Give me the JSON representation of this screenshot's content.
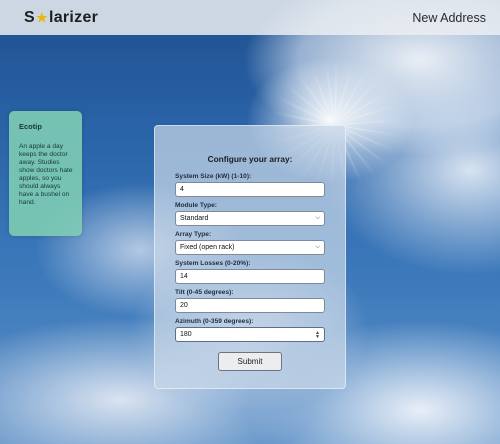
{
  "navbar": {
    "logo_prefix": "S",
    "logo_suffix": "larizer",
    "logo_sun": "★",
    "link": "New Address"
  },
  "ecotip": {
    "title": "Ecotip",
    "body": "An apple a day keeps the doctor away. Studies show doctors hate apples, so you should always have a bushel on hand."
  },
  "form": {
    "title": "Configure your array:",
    "fields": [
      {
        "label": "System Size (kW) (1-10):",
        "value": "4"
      },
      {
        "label": "Module Type:",
        "value": "Standard"
      },
      {
        "label": "Array Type:",
        "value": "Fixed (open rack)"
      },
      {
        "label": "System Losses (0-20%):",
        "value": "14"
      },
      {
        "label": "Tilt (0-45 degrees):",
        "value": "20"
      },
      {
        "label": "Azimuth (0-359 degrees):",
        "value": "180"
      }
    ],
    "submit_label": "Submit"
  },
  "colors": {
    "sun_accent": "#e9b80f",
    "ecotip_bg": "#80ceb4"
  },
  "icons": [
    "select-chevron-icon",
    "number-spinner-icon"
  ]
}
